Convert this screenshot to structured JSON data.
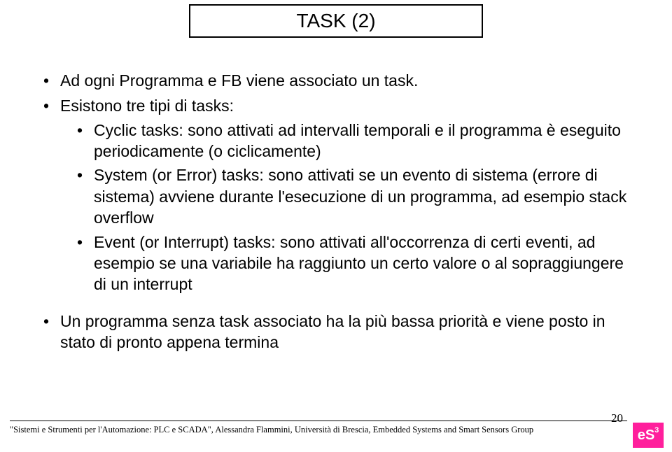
{
  "title": "TASK (2)",
  "bullets": {
    "b1": "Ad ogni Programma e FB viene associato un task.",
    "b2": "Esistono tre tipi di tasks:",
    "b2a": "Cyclic tasks: sono attivati ad intervalli temporali e il programma è eseguito periodicamente (o ciclicamente)",
    "b2b": "System (or Error) tasks: sono attivati se un evento di sistema (errore di sistema) avviene durante l'esecuzione di un programma, ad esempio stack overflow",
    "b2c": "Event (or Interrupt) tasks: sono attivati all'occorrenza di certi eventi, ad esempio se una variabile ha raggiunto un certo valore o al sopraggiungere di un interrupt",
    "b3": "Un programma senza task associato ha la più bassa priorità e viene posto in stato di pronto appena termina"
  },
  "footer": "\"Sistemi e Strumenti per l'Automazione: PLC e SCADA\", Alessandra Flammini, Università di Brescia, Embedded Systems and Smart Sensors Group",
  "page": "20",
  "logo": {
    "main": "eS",
    "sup": "3"
  }
}
